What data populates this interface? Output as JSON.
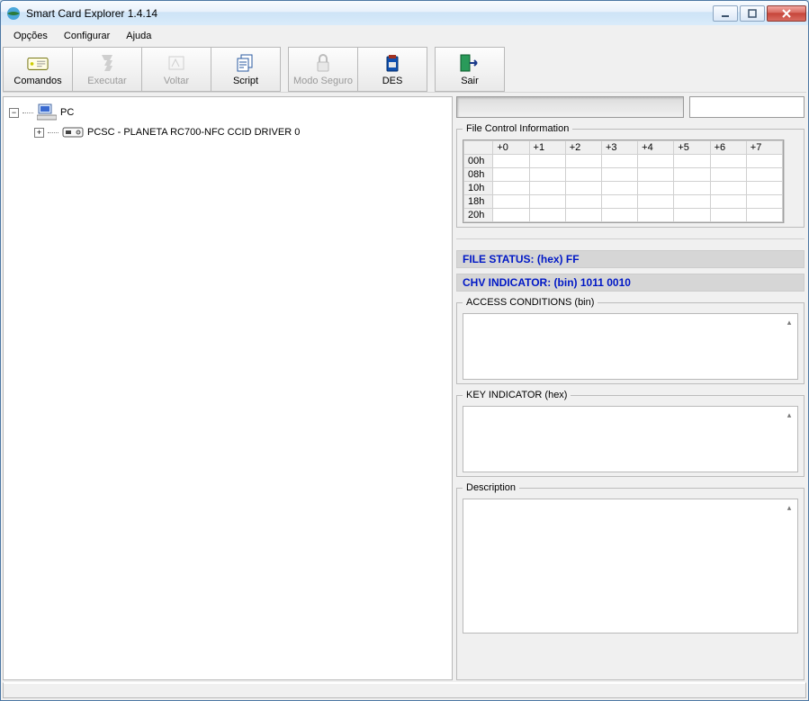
{
  "window": {
    "title": "Smart Card Explorer 1.4.14"
  },
  "menu": {
    "options": "Opções",
    "configure": "Configurar",
    "help": "Ajuda"
  },
  "toolbar": {
    "comandos": "Comandos",
    "executar": "Executar",
    "voltar": "Voltar",
    "script": "Script",
    "seguro": "Modo Seguro",
    "des": "DES",
    "sair": "Sair"
  },
  "tree": {
    "root": "PC",
    "child1": "PCSC - PLANETA RC700-NFC  CCID DRIVER 0"
  },
  "right": {
    "fci_legend": "File Control Information",
    "fci_headers": [
      "",
      "+0",
      "+1",
      "+2",
      "+3",
      "+4",
      "+5",
      "+6",
      "+7"
    ],
    "fci_rows": [
      "00h",
      "08h",
      "10h",
      "18h",
      "20h"
    ],
    "file_status": "FILE STATUS: (hex) FF",
    "chv_indicator": "CHV INDICATOR: (bin) 1011 0010",
    "access_legend": "ACCESS CONDITIONS (bin)",
    "key_legend": "KEY INDICATOR (hex)",
    "desc_legend": "Description",
    "input_placeholder": ""
  }
}
